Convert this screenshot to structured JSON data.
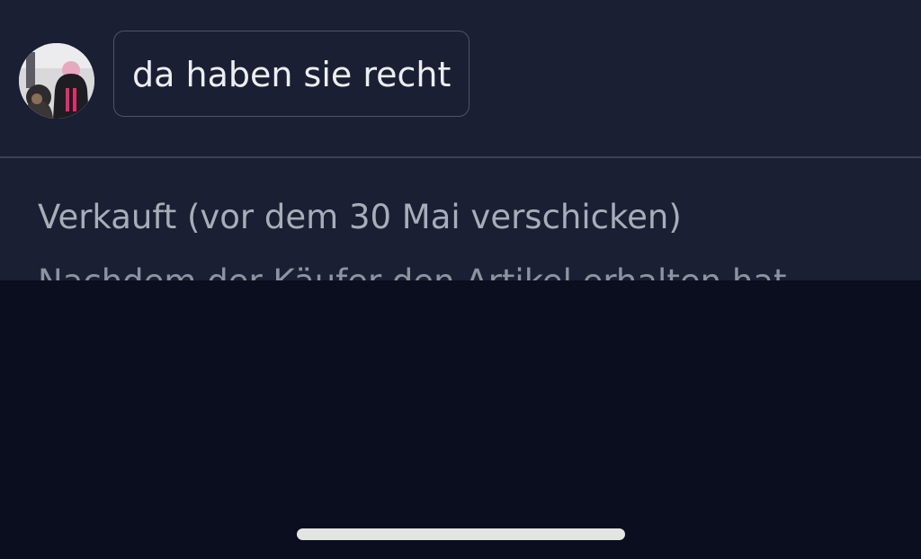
{
  "chat": {
    "message_text": "da haben sie recht"
  },
  "order_status": {
    "title": "Verkauft (vor dem 30 Mai verschicken)",
    "description": "Nachdem der Käufer den Artikel erhalten hat"
  },
  "colors": {
    "background": "#1b1f33",
    "sheet_background": "#0b0e1f",
    "bubble_border": "#4d5366",
    "text_primary": "#eceef2",
    "text_secondary": "#a7adb9",
    "home_indicator": "#e3e5e1"
  }
}
